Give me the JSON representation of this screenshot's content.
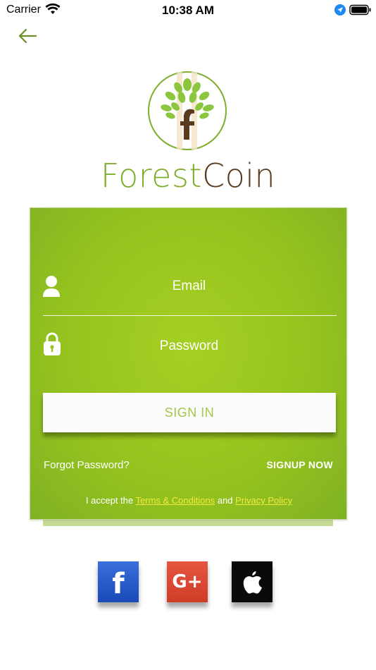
{
  "status_bar": {
    "carrier": "Carrier",
    "time": "10:38 AM"
  },
  "brand": {
    "name_part1": "Forest",
    "name_part2": "Coin"
  },
  "login": {
    "email_placeholder": "Email",
    "password_placeholder": "Password",
    "signin_label": "SIGN IN",
    "forgot_label": "Forgot Password?",
    "signup_label": "SIGNUP NOW",
    "terms_prefix": "I accept the ",
    "terms_link": "Terms & Conditions",
    "terms_and": " and ",
    "privacy_link": "Privacy Policy"
  },
  "social": {
    "facebook_glyph": "f",
    "google_glyph": "G+"
  },
  "colors": {
    "accent_green": "#96c31e",
    "brand_green": "#7fae2c",
    "brand_brown": "#5a3b1d",
    "link_yellow": "#f3ea3e"
  }
}
